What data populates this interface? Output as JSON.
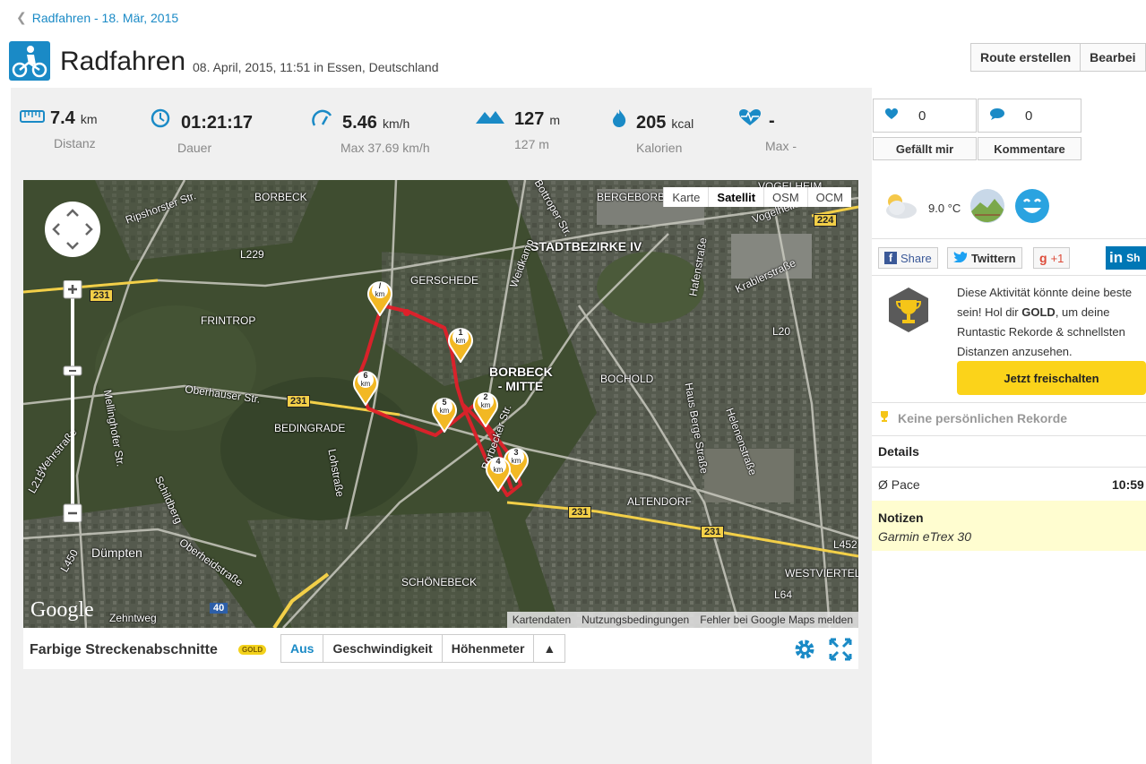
{
  "breadcrumb": {
    "label": "Radfahren - 18. Mär, 2015"
  },
  "header": {
    "title": "Radfahren",
    "subtitle": "08. April, 2015, 11:51 in Essen, Deutschland",
    "route_button": "Route erstellen",
    "edit_button": "Bearbei"
  },
  "stats": [
    {
      "icon": "ruler-icon",
      "value": "7.4",
      "unit": "km",
      "label": "Distanz"
    },
    {
      "icon": "clock-icon",
      "value": "01:21:17",
      "unit": "",
      "label": "Dauer"
    },
    {
      "icon": "speedometer-icon",
      "value": "5.46",
      "unit": "km/h",
      "label": "Max 37.69 km/h"
    },
    {
      "icon": "mountains-icon",
      "value": "127",
      "unit": "m",
      "label": "127 m"
    },
    {
      "icon": "flame-icon",
      "value": "205",
      "unit": "kcal",
      "label": "Kalorien"
    },
    {
      "icon": "heart-rate-icon",
      "value": "-",
      "unit": "",
      "label": "Max -"
    }
  ],
  "social": {
    "likes": "0",
    "comments": "0",
    "like_button": "Gefällt mir",
    "comment_button": "Kommentare"
  },
  "map": {
    "types": [
      "Karte",
      "Satellit",
      "OSM",
      "OCM"
    ],
    "active_type": "Satellit",
    "footer": [
      "Kartendaten",
      "Nutzungsbedingungen",
      "Fehler bei Google Maps melden"
    ],
    "logo": "Google",
    "labels": {
      "borbeck": "BORBECK",
      "ripshorster": "Ripshorster Str.",
      "bergeborbe": "BERGEBORBE",
      "stadtbezirk": "STADTBEZIRKE IV",
      "gerschede": "GERSCHEDE",
      "frintrop": "FRINTROP",
      "borbeck_mitte": "BORBECK - MITTE",
      "bochold": "BOCHOLD",
      "oberhauser": "Oberhauser Str.",
      "bedingrade": "BEDINGRADE",
      "altendorf": "ALTENDORF",
      "dumpten": "Dümpten",
      "schonebeck": "SCHÖNEBECK",
      "westviertel": "WESTVIERTEL",
      "zehntweg": "Zehntweg",
      "road_231": "231",
      "road_224": "224",
      "road_40": "40",
      "road_l229": "L229",
      "road_l20": "L20",
      "road_l450": "L450",
      "road_l452": "L452",
      "road_l64": "L64",
      "road_l215": "L215",
      "weidkamp": "Weidkamp",
      "bottroper": "Bottroper Str.",
      "hafenstrasse": "Hafenstraße",
      "lohstrasse": "Lohstraße",
      "mellinghofer": "Mellinghofer Str.",
      "wehrstrasse": "Wehrstraße",
      "schildberg": "Schildberg",
      "oberheidstrasse": "Oberheidstraße",
      "krablerstrasse": "Krablerstraße",
      "vogelheimer": "Vogelheimer",
      "helenenstrasse": "Helenenstraße",
      "haus_berge": "Haus Berge Straße",
      "borbecker": "Borbecker Str.",
      "vogelheim": "VOGELHEIM"
    },
    "markers": [
      "km",
      "1\nkm",
      "2\nkm",
      "3\nkm",
      "4\nkm",
      "5\nkm",
      "6\nkm"
    ]
  },
  "segments": {
    "title": "Farbige Streckenabschnitte",
    "badge": "GOLD",
    "options": [
      "Aus",
      "Geschwindigkeit",
      "Höhenmeter"
    ],
    "active": "Aus"
  },
  "weather": {
    "temperature": "9.0 °C"
  },
  "share": {
    "facebook": "Share",
    "twitter": "Twittern",
    "google": "+1",
    "linkedin": "Sh"
  },
  "promo": {
    "text_before": "Diese Aktivität könnte deine beste sein! Hol dir ",
    "text_bold": "GOLD",
    "text_after": ", um deine Runtastic Rekorde & schnellsten Distanzen anzusehen.",
    "button": "Jetzt freischalten"
  },
  "records": {
    "label": "Keine persönlichen Rekorde"
  },
  "details": {
    "heading": "Details",
    "pace_label": "Ø Pace",
    "pace_value": "10:59"
  },
  "notes": {
    "heading": "Notizen",
    "text": "Garmin eTrex 30"
  }
}
